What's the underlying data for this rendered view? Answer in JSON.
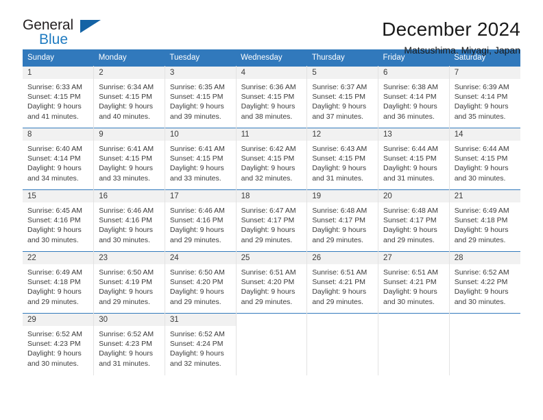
{
  "logo": {
    "word_one": "General",
    "word_two": "Blue",
    "triangle_color": "#1463a5",
    "blue_color": "#1f7bc1"
  },
  "header": {
    "title": "December 2024",
    "subtitle": "Matsushima, Miyagi, Japan"
  },
  "theme": {
    "header_blue": "#3179bc",
    "daynum_band": "#f1f1f1",
    "text": "#3a3a3a"
  },
  "weekdays": [
    "Sunday",
    "Monday",
    "Tuesday",
    "Wednesday",
    "Thursday",
    "Friday",
    "Saturday"
  ],
  "days": [
    {
      "day": "1",
      "sunrise": "Sunrise: 6:33 AM",
      "sunset": "Sunset: 4:15 PM",
      "daylight1": "Daylight: 9 hours",
      "daylight2": "and 41 minutes."
    },
    {
      "day": "2",
      "sunrise": "Sunrise: 6:34 AM",
      "sunset": "Sunset: 4:15 PM",
      "daylight1": "Daylight: 9 hours",
      "daylight2": "and 40 minutes."
    },
    {
      "day": "3",
      "sunrise": "Sunrise: 6:35 AM",
      "sunset": "Sunset: 4:15 PM",
      "daylight1": "Daylight: 9 hours",
      "daylight2": "and 39 minutes."
    },
    {
      "day": "4",
      "sunrise": "Sunrise: 6:36 AM",
      "sunset": "Sunset: 4:15 PM",
      "daylight1": "Daylight: 9 hours",
      "daylight2": "and 38 minutes."
    },
    {
      "day": "5",
      "sunrise": "Sunrise: 6:37 AM",
      "sunset": "Sunset: 4:15 PM",
      "daylight1": "Daylight: 9 hours",
      "daylight2": "and 37 minutes."
    },
    {
      "day": "6",
      "sunrise": "Sunrise: 6:38 AM",
      "sunset": "Sunset: 4:14 PM",
      "daylight1": "Daylight: 9 hours",
      "daylight2": "and 36 minutes."
    },
    {
      "day": "7",
      "sunrise": "Sunrise: 6:39 AM",
      "sunset": "Sunset: 4:14 PM",
      "daylight1": "Daylight: 9 hours",
      "daylight2": "and 35 minutes."
    },
    {
      "day": "8",
      "sunrise": "Sunrise: 6:40 AM",
      "sunset": "Sunset: 4:14 PM",
      "daylight1": "Daylight: 9 hours",
      "daylight2": "and 34 minutes."
    },
    {
      "day": "9",
      "sunrise": "Sunrise: 6:41 AM",
      "sunset": "Sunset: 4:15 PM",
      "daylight1": "Daylight: 9 hours",
      "daylight2": "and 33 minutes."
    },
    {
      "day": "10",
      "sunrise": "Sunrise: 6:41 AM",
      "sunset": "Sunset: 4:15 PM",
      "daylight1": "Daylight: 9 hours",
      "daylight2": "and 33 minutes."
    },
    {
      "day": "11",
      "sunrise": "Sunrise: 6:42 AM",
      "sunset": "Sunset: 4:15 PM",
      "daylight1": "Daylight: 9 hours",
      "daylight2": "and 32 minutes."
    },
    {
      "day": "12",
      "sunrise": "Sunrise: 6:43 AM",
      "sunset": "Sunset: 4:15 PM",
      "daylight1": "Daylight: 9 hours",
      "daylight2": "and 31 minutes."
    },
    {
      "day": "13",
      "sunrise": "Sunrise: 6:44 AM",
      "sunset": "Sunset: 4:15 PM",
      "daylight1": "Daylight: 9 hours",
      "daylight2": "and 31 minutes."
    },
    {
      "day": "14",
      "sunrise": "Sunrise: 6:44 AM",
      "sunset": "Sunset: 4:15 PM",
      "daylight1": "Daylight: 9 hours",
      "daylight2": "and 30 minutes."
    },
    {
      "day": "15",
      "sunrise": "Sunrise: 6:45 AM",
      "sunset": "Sunset: 4:16 PM",
      "daylight1": "Daylight: 9 hours",
      "daylight2": "and 30 minutes."
    },
    {
      "day": "16",
      "sunrise": "Sunrise: 6:46 AM",
      "sunset": "Sunset: 4:16 PM",
      "daylight1": "Daylight: 9 hours",
      "daylight2": "and 30 minutes."
    },
    {
      "day": "17",
      "sunrise": "Sunrise: 6:46 AM",
      "sunset": "Sunset: 4:16 PM",
      "daylight1": "Daylight: 9 hours",
      "daylight2": "and 29 minutes."
    },
    {
      "day": "18",
      "sunrise": "Sunrise: 6:47 AM",
      "sunset": "Sunset: 4:17 PM",
      "daylight1": "Daylight: 9 hours",
      "daylight2": "and 29 minutes."
    },
    {
      "day": "19",
      "sunrise": "Sunrise: 6:48 AM",
      "sunset": "Sunset: 4:17 PM",
      "daylight1": "Daylight: 9 hours",
      "daylight2": "and 29 minutes."
    },
    {
      "day": "20",
      "sunrise": "Sunrise: 6:48 AM",
      "sunset": "Sunset: 4:17 PM",
      "daylight1": "Daylight: 9 hours",
      "daylight2": "and 29 minutes."
    },
    {
      "day": "21",
      "sunrise": "Sunrise: 6:49 AM",
      "sunset": "Sunset: 4:18 PM",
      "daylight1": "Daylight: 9 hours",
      "daylight2": "and 29 minutes."
    },
    {
      "day": "22",
      "sunrise": "Sunrise: 6:49 AM",
      "sunset": "Sunset: 4:18 PM",
      "daylight1": "Daylight: 9 hours",
      "daylight2": "and 29 minutes."
    },
    {
      "day": "23",
      "sunrise": "Sunrise: 6:50 AM",
      "sunset": "Sunset: 4:19 PM",
      "daylight1": "Daylight: 9 hours",
      "daylight2": "and 29 minutes."
    },
    {
      "day": "24",
      "sunrise": "Sunrise: 6:50 AM",
      "sunset": "Sunset: 4:20 PM",
      "daylight1": "Daylight: 9 hours",
      "daylight2": "and 29 minutes."
    },
    {
      "day": "25",
      "sunrise": "Sunrise: 6:51 AM",
      "sunset": "Sunset: 4:20 PM",
      "daylight1": "Daylight: 9 hours",
      "daylight2": "and 29 minutes."
    },
    {
      "day": "26",
      "sunrise": "Sunrise: 6:51 AM",
      "sunset": "Sunset: 4:21 PM",
      "daylight1": "Daylight: 9 hours",
      "daylight2": "and 29 minutes."
    },
    {
      "day": "27",
      "sunrise": "Sunrise: 6:51 AM",
      "sunset": "Sunset: 4:21 PM",
      "daylight1": "Daylight: 9 hours",
      "daylight2": "and 30 minutes."
    },
    {
      "day": "28",
      "sunrise": "Sunrise: 6:52 AM",
      "sunset": "Sunset: 4:22 PM",
      "daylight1": "Daylight: 9 hours",
      "daylight2": "and 30 minutes."
    },
    {
      "day": "29",
      "sunrise": "Sunrise: 6:52 AM",
      "sunset": "Sunset: 4:23 PM",
      "daylight1": "Daylight: 9 hours",
      "daylight2": "and 30 minutes."
    },
    {
      "day": "30",
      "sunrise": "Sunrise: 6:52 AM",
      "sunset": "Sunset: 4:23 PM",
      "daylight1": "Daylight: 9 hours",
      "daylight2": "and 31 minutes."
    },
    {
      "day": "31",
      "sunrise": "Sunrise: 6:52 AM",
      "sunset": "Sunset: 4:24 PM",
      "daylight1": "Daylight: 9 hours",
      "daylight2": "and 32 minutes."
    }
  ],
  "grid": {
    "leading_blanks": 0,
    "trailing_blanks": 4
  }
}
